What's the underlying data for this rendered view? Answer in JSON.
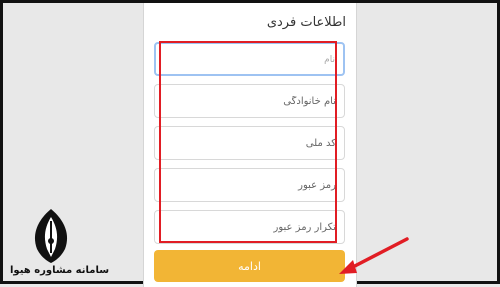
{
  "form": {
    "title": "اطلاعات فردی",
    "fields": [
      {
        "placeholder": "نام"
      },
      {
        "placeholder": "نام خانوادگی"
      },
      {
        "placeholder": "کد ملی"
      },
      {
        "placeholder": "رمز عبور"
      },
      {
        "placeholder": "تکرار رمز عبور"
      }
    ],
    "continue_label": "ادامه"
  },
  "branding": {
    "site_name": "سامانه مشاوره هیوا"
  },
  "colors": {
    "accent": "#f2b535",
    "highlight": "#e11d24",
    "focus_border": "#9ec3f2"
  },
  "icons": [
    "pen-nib-logo-icon",
    "red-arrow-icon"
  ]
}
